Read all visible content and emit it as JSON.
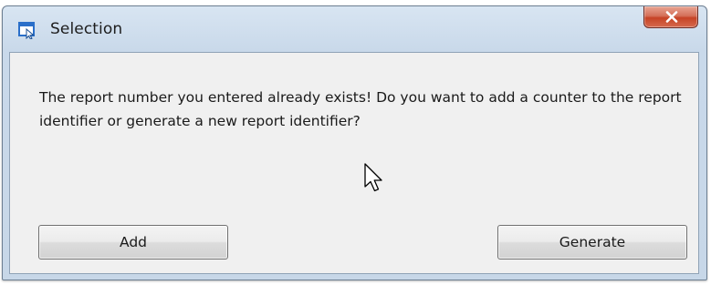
{
  "window": {
    "title": "Selection",
    "icon": "selection-app-icon",
    "close_icon": "close-x-icon"
  },
  "dialog": {
    "message": "The report number you entered already exists! Do you want to add a counter to the report identifier or generate a new report identifier?"
  },
  "buttons": {
    "add_label": "Add",
    "generate_label": "Generate"
  },
  "colors": {
    "frame": "#c9d9ea",
    "client_background": "#f0f0f0",
    "close_button": "#c64326",
    "app_icon": "#2a6fc9"
  }
}
